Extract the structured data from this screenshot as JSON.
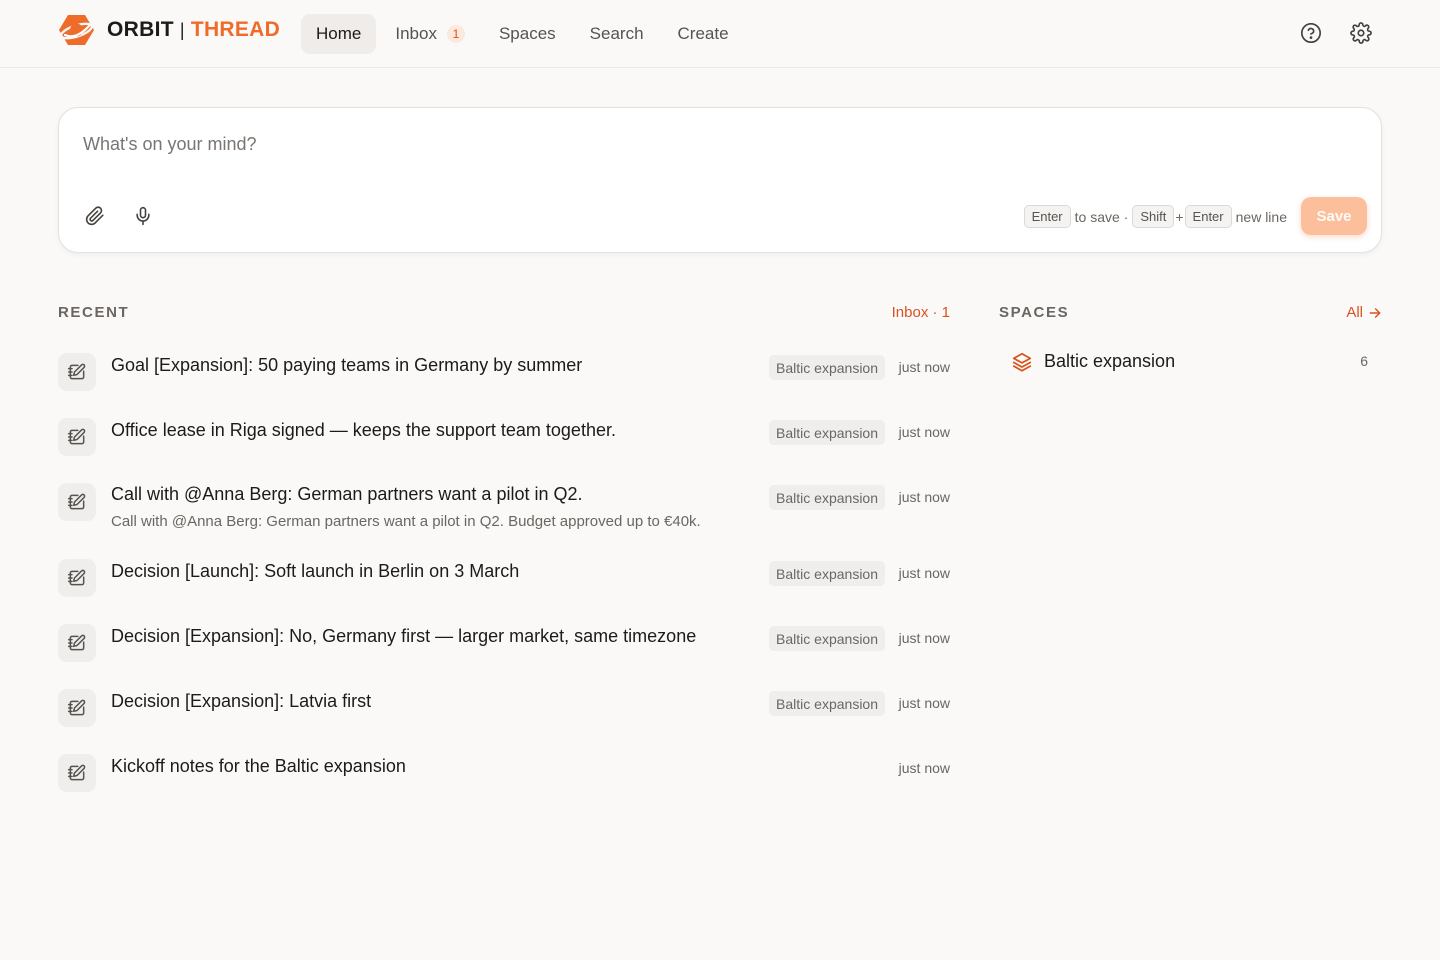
{
  "brand": {
    "name_left": "ORBIT",
    "separator": "|",
    "name_right": "THREAD",
    "accent": "#ee6b2a"
  },
  "nav": {
    "items": [
      {
        "label": "Home",
        "active": true
      },
      {
        "label": "Inbox",
        "badge": "1"
      },
      {
        "label": "Spaces"
      },
      {
        "label": "Search"
      },
      {
        "label": "Create"
      }
    ]
  },
  "top_icons": [
    "help-circle-icon",
    "settings-gear-icon"
  ],
  "composer": {
    "placeholder": "What's on your mind?",
    "value": "",
    "tools": [
      "paperclip-icon",
      "microphone-icon"
    ],
    "hint_key_enter": "Enter",
    "hint_to_save": "to save ·",
    "hint_key_shift": "Shift",
    "hint_plus": "+",
    "hint_key_enter2": "Enter",
    "hint_new_line": "new line",
    "save_label": "Save"
  },
  "recent": {
    "heading": "RECENT",
    "link": "Inbox · 1",
    "items": [
      {
        "title": "Goal [Expansion]: 50 paying teams in Germany by summer",
        "subtitle": "",
        "tag": "Baltic expansion",
        "time": "just now"
      },
      {
        "title": "Office lease in Riga signed — keeps the support team together.",
        "subtitle": "",
        "tag": "Baltic expansion",
        "time": "just now"
      },
      {
        "title": "Call with @Anna Berg: German partners want a pilot in Q2.",
        "subtitle": "Call with @Anna Berg: German partners want a pilot in Q2. Budget approved up to €40k.",
        "tag": "Baltic expansion",
        "time": "just now"
      },
      {
        "title": "Decision [Launch]: Soft launch in Berlin on 3 March",
        "subtitle": "",
        "tag": "Baltic expansion",
        "time": "just now"
      },
      {
        "title": "Decision [Expansion]: No, Germany first — larger market, same timezone",
        "subtitle": "",
        "tag": "Baltic expansion",
        "time": "just now"
      },
      {
        "title": "Decision [Expansion]: Latvia first",
        "subtitle": "",
        "tag": "Baltic expansion",
        "time": "just now"
      },
      {
        "title": "Kickoff notes for the Baltic expansion",
        "subtitle": "",
        "tag": "",
        "time": "just now"
      }
    ]
  },
  "spaces": {
    "heading": "SPACES",
    "link": "All",
    "items": [
      {
        "name": "Baltic expansion",
        "count": "6",
        "icon": "layers-icon"
      }
    ]
  }
}
